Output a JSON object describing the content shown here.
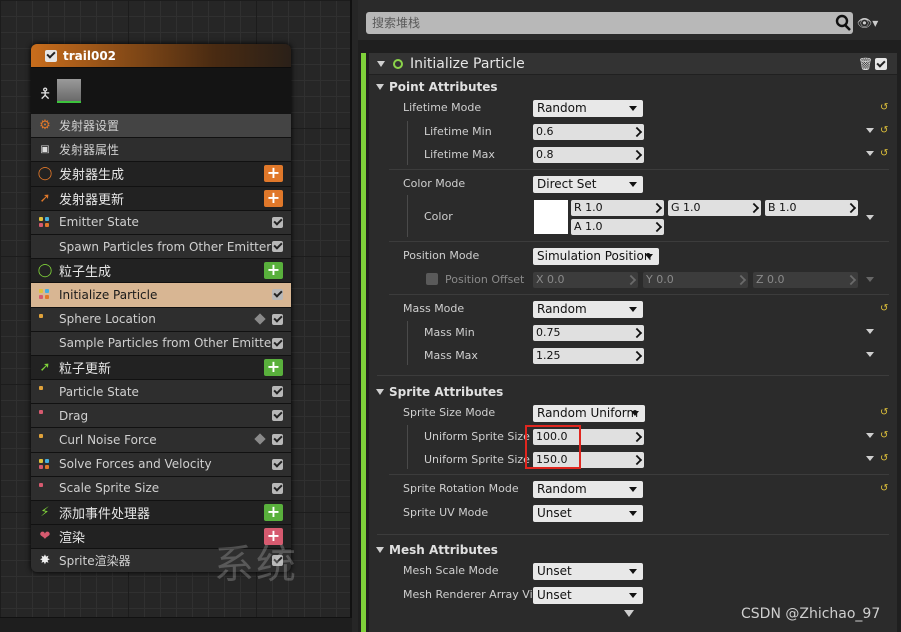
{
  "left": {
    "emitter_title": "trail002",
    "watermark": "系统",
    "rows": [
      {
        "label": "发射器设置",
        "kind": "emset",
        "icon": "emitter-settings-icon",
        "right": "none"
      },
      {
        "label": "发射器属性",
        "kind": "plain",
        "icon": "cpu-icon",
        "right": "none"
      },
      {
        "label": "发射器生成",
        "kind": "cat",
        "icon": "spawn-ring-icon",
        "right": "plus-orange"
      },
      {
        "label": "发射器更新",
        "kind": "cat",
        "icon": "update-arrow-icon",
        "right": "plus-orange"
      },
      {
        "label": "Emitter State",
        "kind": "plain",
        "icon": "module-dots-icon",
        "right": "check"
      },
      {
        "label": "Spawn Particles from Other Emitter",
        "kind": "plain",
        "icon": "none",
        "right": "check"
      },
      {
        "label": "粒子生成",
        "kind": "cat",
        "icon": "particle-spawn-ring-icon",
        "right": "plus-green"
      },
      {
        "label": "Initialize Particle",
        "kind": "selected",
        "icon": "module-dots-icon",
        "right": "check"
      },
      {
        "label": "Sphere Location",
        "kind": "plain",
        "icon": "module-dot-icon",
        "right": "cube-check"
      },
      {
        "label": "Sample Particles from Other Emitter",
        "kind": "plain",
        "icon": "none",
        "right": "check"
      },
      {
        "label": "粒子更新",
        "kind": "cat",
        "icon": "particle-update-arrow-icon",
        "right": "plus-green"
      },
      {
        "label": "Particle State",
        "kind": "plain",
        "icon": "module-dot-icon",
        "right": "check"
      },
      {
        "label": "Drag",
        "kind": "plain",
        "icon": "module-dot-icon",
        "right": "check"
      },
      {
        "label": "Curl Noise Force",
        "kind": "plain",
        "icon": "module-dot-icon",
        "right": "cube-check"
      },
      {
        "label": "Solve Forces and Velocity",
        "kind": "plain",
        "icon": "module-dots-icon",
        "right": "check"
      },
      {
        "label": "Scale Sprite Size",
        "kind": "plain",
        "icon": "module-dot-icon",
        "right": "check"
      },
      {
        "label": "添加事件处理器",
        "kind": "cat",
        "icon": "event-handler-icon",
        "right": "plus-green"
      },
      {
        "label": "渲染",
        "kind": "cat",
        "icon": "render-heart-icon",
        "right": "plus-pink"
      },
      {
        "label": "Sprite渲染器",
        "kind": "plain",
        "icon": "sprite-burst-icon",
        "right": "check"
      }
    ]
  },
  "right": {
    "search_placeholder": "搜索堆栈",
    "module_title": "Initialize Particle",
    "sections": {
      "point": "Point Attributes",
      "sprite": "Sprite Attributes",
      "mesh": "Mesh Attributes"
    },
    "props": {
      "lifetime_mode": {
        "label": "Lifetime Mode",
        "value": "Random"
      },
      "lifetime_min": {
        "label": "Lifetime Min",
        "value": "0.6"
      },
      "lifetime_max": {
        "label": "Lifetime Max",
        "value": "0.8"
      },
      "color_mode": {
        "label": "Color Mode",
        "value": "Direct Set"
      },
      "color": {
        "label": "Color",
        "r": "R 1.0",
        "g": "G 1.0",
        "b": "B 1.0",
        "a": "A 1.0"
      },
      "position_mode": {
        "label": "Position Mode",
        "value": "Simulation Position"
      },
      "position_offset": {
        "label": "Position Offset",
        "x": "X 0.0",
        "y": "Y 0.0",
        "z": "Z 0.0"
      },
      "mass_mode": {
        "label": "Mass Mode",
        "value": "Random"
      },
      "mass_min": {
        "label": "Mass Min",
        "value": "0.75"
      },
      "mass_max": {
        "label": "Mass Max",
        "value": "1.25"
      },
      "sprite_size_mode": {
        "label": "Sprite Size Mode",
        "value": "Random Uniform"
      },
      "uniform_size_1": {
        "label": "Uniform Sprite Size",
        "value": "100.0"
      },
      "uniform_size_2": {
        "label": "Uniform Sprite Size",
        "value": "150.0"
      },
      "sprite_rotation_mode": {
        "label": "Sprite Rotation Mode",
        "value": "Random"
      },
      "sprite_uv_mode": {
        "label": "Sprite UV Mode",
        "value": "Unset"
      },
      "mesh_scale_mode": {
        "label": "Mesh Scale Mode",
        "value": "Unset"
      },
      "mesh_renderer_array": {
        "label": "Mesh Renderer Array Vi",
        "value": "Unset"
      }
    },
    "watermark_text": "CSDN @Zhichao_97"
  },
  "colors": {
    "accent_green": "#7fd13a",
    "selected_row": "#d8b693",
    "highlight_red": "#e0261f",
    "header_orange": "#c86d1c"
  }
}
